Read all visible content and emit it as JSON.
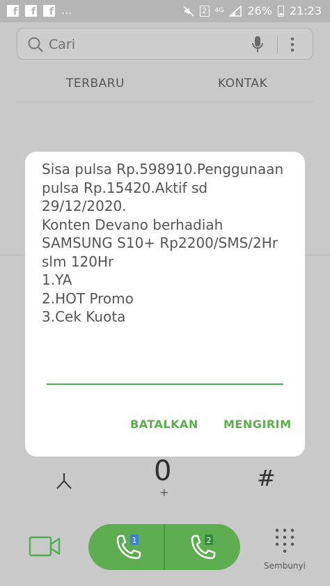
{
  "status_bar": {
    "notification_icons": [
      "facebook-icon",
      "facebook-icon",
      "facebook-icon"
    ],
    "more_notifications": "...",
    "sim_slot": "2",
    "network": "4G",
    "battery_percent": "26%",
    "time": "21:23"
  },
  "search": {
    "placeholder": "Cari",
    "icons": [
      "search-icon",
      "microphone-icon",
      "more-vertical-icon"
    ]
  },
  "tabs": [
    {
      "label": "TERBARU"
    },
    {
      "label": "KONTAK"
    }
  ],
  "dialog": {
    "message": "Sisa pulsa Rp.598910.Penggunaan\npulsa Rp.15420.Aktif sd\n29/12/2020.\nKonten Devano berhadiah\nSAMSUNG S10+ Rp2200/SMS/2Hr\nslm 120Hr\n1.YA\n2.HOT Promo\n3.Cek Kuota",
    "input_value": "",
    "cancel_label": "BATALKAN",
    "send_label": "MENGIRIM"
  },
  "dialpad": {
    "star": "*",
    "zero": "0",
    "zero_sub": "+",
    "hash": "#"
  },
  "bottom": {
    "sim1_label": "1",
    "sim2_label": "2",
    "hide_label": "Sembunyi",
    "call_color": "#5eae51"
  }
}
